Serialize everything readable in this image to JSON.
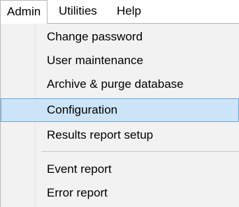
{
  "menubar": {
    "items": [
      {
        "label": "Admin"
      },
      {
        "label": "Utilities"
      },
      {
        "label": "Help"
      }
    ]
  },
  "dropdown": {
    "items": [
      {
        "label": "Change password"
      },
      {
        "label": "User maintenance"
      },
      {
        "label": "Archive & purge database"
      },
      {
        "label": "Configuration",
        "highlighted": true
      },
      {
        "label": "Results report setup"
      },
      {
        "label": "Event report"
      },
      {
        "label": "Error report"
      }
    ]
  },
  "colors": {
    "highlight_bg": "#cce4f7",
    "highlight_border": "#6da8d7",
    "menu_bg": "#f2f2f2"
  }
}
